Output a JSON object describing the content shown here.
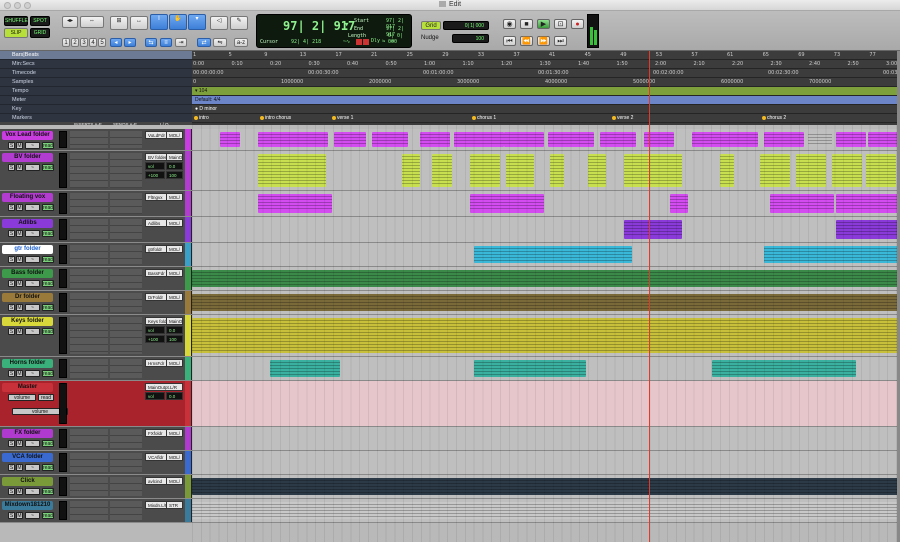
{
  "window": {
    "title": "Edit"
  },
  "toolbar": {
    "modes": [
      "SHUFFLE",
      "SPOT",
      "SLIP",
      "GRID"
    ],
    "zoom_presets": [
      "1",
      "2",
      "3",
      "4",
      "5"
    ],
    "counter": {
      "main": "97| 2| 917",
      "start_label": "Start",
      "start_value": "97| 2| 917",
      "end_label": "End",
      "end_value": "97| 2| 917",
      "length_label": "Length",
      "length_value": "0| 0| 000",
      "cursor_label": "Cursor",
      "cursor_value": "92| 4| 218",
      "dly_label": "Dly"
    },
    "grid": {
      "label": "Grid",
      "value": "0| 1| 000"
    },
    "nudge": {
      "label": "Nudge",
      "value": "100"
    }
  },
  "rulers": {
    "labels": [
      "Bars|Beats",
      "Min:Secs",
      "Timecode",
      "Samples",
      "Tempo",
      "Meter",
      "Key",
      "Markers"
    ],
    "bars": [
      "1",
      "5",
      "9",
      "13",
      "17",
      "21",
      "25",
      "29",
      "33",
      "37",
      "41",
      "45",
      "49",
      "53",
      "57",
      "61",
      "65",
      "69",
      "73",
      "77"
    ],
    "minsecs": [
      "0:00",
      "0:10",
      "0:20",
      "0:30",
      "0:40",
      "0:50",
      "1:00",
      "1:10",
      "1:20",
      "1:30",
      "1:40",
      "1:50",
      "2:00",
      "2:10",
      "2:20",
      "2:30",
      "2:40",
      "2:50",
      "3:00"
    ],
    "timecode": [
      "00:00:00:00",
      "00:00:30:00",
      "00:01:00:00",
      "00:01:30:00",
      "00:02:00:00",
      "00:02:30:00",
      "00:03:00:00"
    ],
    "samples": [
      "0",
      "1000000",
      "2000000",
      "3000000",
      "4000000",
      "5000000",
      "6000000",
      "7000000",
      "8000000"
    ],
    "tempo": "104",
    "meter": "Default: 4/4",
    "key": "D minor",
    "markers": [
      "intro",
      "intro chorus",
      "verse 1",
      "chorus 1",
      "verse 2",
      "chorus 2"
    ]
  },
  "columns": {
    "inserts": "INSERTS A-E",
    "sends": "SENDS A-E",
    "io": "I / O"
  },
  "tracks": [
    {
      "name": "Vox Lead folder",
      "color": "#c93ce0",
      "io1": "VoLdFdr",
      "io2": "MOL/",
      "height": 22
    },
    {
      "name": "BV folder",
      "color": "#b23cd0",
      "io1": "BV folder",
      "io2": "MainOutpt.L/R",
      "vol": "vol",
      "vol_value": "0.0",
      "pan_l": "+100",
      "pan_r": "100",
      "height": 40
    },
    {
      "name": "Floating vox",
      "color": "#b23cd0",
      "io1": "Fltngvx",
      "io2": "MOL/",
      "height": 26
    },
    {
      "name": "Adlibs",
      "color": "#8a3ad8",
      "io1": "Adlibs",
      "io2": "MOL/",
      "height": 26
    },
    {
      "name": "gtr folder",
      "color": "#3aa0c8",
      "io1": "gtrfoldr",
      "io2": "MOL/",
      "height": 24
    },
    {
      "name": "Bass folder",
      "color": "#3c9a4a",
      "io1": "BassFdr",
      "io2": "MOL/",
      "height": 24
    },
    {
      "name": "Dr folder",
      "color": "#9a7a3a",
      "io1": "DrFoldr",
      "io2": "MOL/",
      "height": 24
    },
    {
      "name": "Keys folder",
      "color": "#d8d83a",
      "io1": "Keys folder",
      "io2": "MainOutpt.L/R",
      "vol": "vol",
      "vol_value": "0.0",
      "pan_l": "+100",
      "pan_r": "100",
      "height": 42
    },
    {
      "name": "Horns folder",
      "color": "#3ab07a",
      "io1": "HrnsFdr",
      "io2": "MOL/",
      "height": 24
    },
    {
      "name": "Master",
      "color": "#c8303a",
      "io1": "MainOutpt.L/R",
      "io2": "",
      "vol": "vol",
      "vol_value": "0.0",
      "automation": "volume",
      "read": "read",
      "height": 46
    },
    {
      "name": "FX folder",
      "color": "#b03ad0",
      "io1": "FXfoldr",
      "io2": "MOL/",
      "height": 24
    },
    {
      "name": "VCA folder",
      "color": "#3a6ad0",
      "io1": "VCAfldr",
      "io2": "MOL/",
      "height": 24
    },
    {
      "name": "Click",
      "color": "#7a9a3a",
      "io1": "avlcind",
      "io2": "MOL/",
      "height": 24
    },
    {
      "name": "Mixdown181210",
      "color": "#3a7a9a",
      "io1": "Mixdn.L/R",
      "io2": "STR",
      "height": 24
    }
  ],
  "track_buttons": {
    "solo": "S",
    "mute": "M",
    "automation_mode": "waveform",
    "read": "read"
  },
  "colors": {
    "accent_selected": "#3d7fd8",
    "counter_text": "#8ef08e",
    "playhead": "#e03a2a"
  }
}
